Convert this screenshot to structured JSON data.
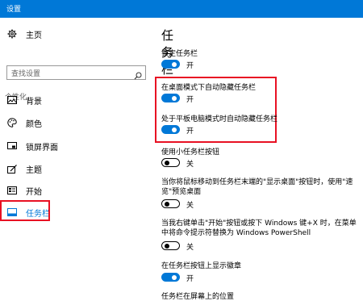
{
  "window": {
    "title": "设置"
  },
  "sidebar": {
    "home": {
      "label": "主页",
      "icon": "gear-icon"
    },
    "search": {
      "placeholder": "查找设置",
      "icon": "search-icon"
    },
    "section": "个性化",
    "items": [
      {
        "label": "背景",
        "icon": "image-icon",
        "selected": false
      },
      {
        "label": "颜色",
        "icon": "palette-icon",
        "selected": false
      },
      {
        "label": "锁屏界面",
        "icon": "lock-screen-icon",
        "selected": false
      },
      {
        "label": "主题",
        "icon": "brush-icon",
        "selected": false
      },
      {
        "label": "开始",
        "icon": "start-icon",
        "selected": false
      },
      {
        "label": "任务栏",
        "icon": "taskbar-icon",
        "selected": true
      }
    ]
  },
  "main": {
    "title": "任务栏",
    "settings": [
      {
        "label": "锁定任务栏",
        "state": "开",
        "on": true
      },
      {
        "label": "在桌面模式下自动隐藏任务栏",
        "state": "开",
        "on": true
      },
      {
        "label": "处于平板电脑模式时自动隐藏任务栏",
        "state": "开",
        "on": true
      },
      {
        "label": "使用小任务栏按钮",
        "state": "关",
        "on": false
      },
      {
        "label": "当你将鼠标移动到任务栏末端的\"显示桌面\"按钮时，使用\"速览\"预览桌面",
        "state": "关",
        "on": false
      },
      {
        "label": "当我右键单击\"开始\"按钮或按下 Windows 键+X 时，在菜单中将命令提示符替换为 Windows PowerShell",
        "state": "关",
        "on": false
      },
      {
        "label": "在任务栏按钮上显示徽章",
        "state": "开",
        "on": true
      }
    ],
    "next_heading": "任务栏在屏幕上的位置"
  },
  "colors": {
    "accent": "#0078d7",
    "highlight": "#e81123"
  }
}
